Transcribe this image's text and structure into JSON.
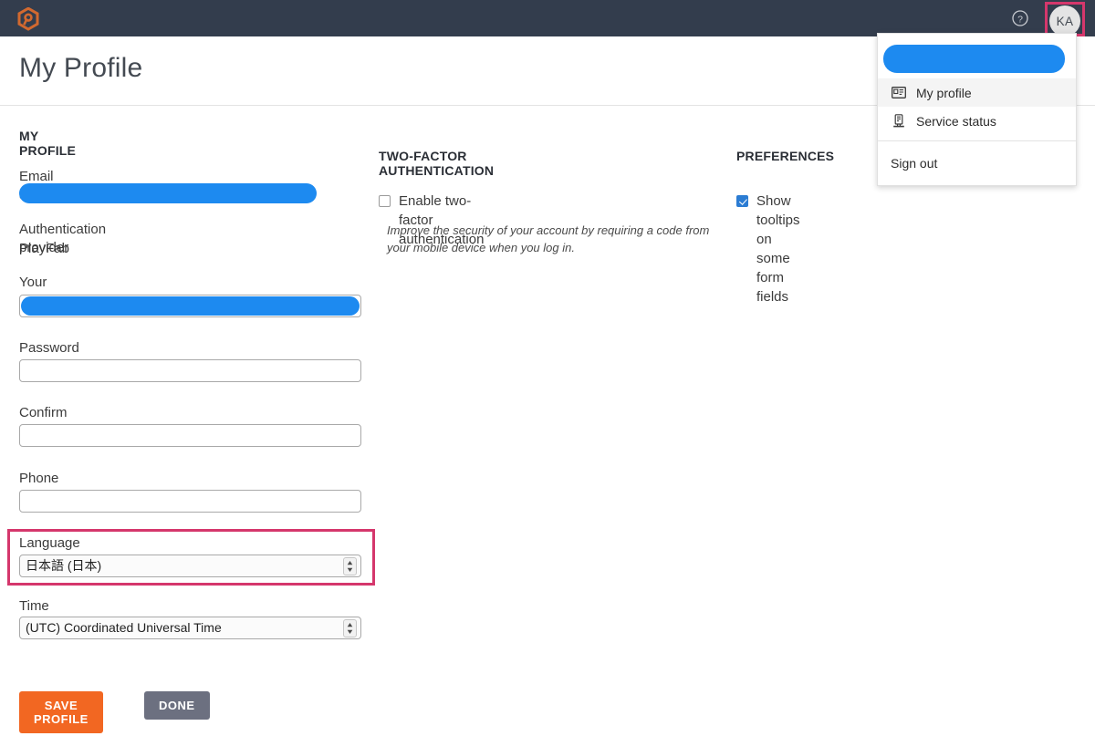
{
  "topbar": {
    "logo_name": "playfab-logo",
    "help_label": "help-icon",
    "avatar_initials": "KA"
  },
  "page": {
    "title": "My Profile"
  },
  "colors": {
    "topbar_bg": "#333d4d",
    "accent_orange": "#f26722",
    "highlight_pink": "#d5376c",
    "redaction_blue": "#1d8af0",
    "checkbox_blue": "#2b7cd3",
    "done_gray": "#6c7080"
  },
  "profile": {
    "section_title": "MY PROFILE",
    "email_label": "Email address",
    "email_value": "",
    "auth_provider_label": "Authentication provider",
    "auth_provider_value": "PlayFab",
    "name_label": "Your name",
    "name_value": "",
    "password_label": "Password",
    "password_value": "",
    "confirm_password_label": "Confirm password",
    "confirm_password_value": "",
    "phone_label": "Phone number",
    "phone_value": "",
    "language_label": "Language",
    "language_value": "日本語 (日本)",
    "timezone_label": "Time zone",
    "timezone_value": "(UTC) Coordinated Universal Time"
  },
  "twofactor": {
    "section_title": "TWO-FACTOR AUTHENTICATION",
    "enable_label": "Enable two-factor authentication",
    "enable_checked": false,
    "hint_line1": "Improve the security of your account by requiring a code from",
    "hint_line2": "your mobile device when you log in."
  },
  "preferences": {
    "section_title": "PREFERENCES",
    "tooltips_label": "Show tooltips on some form fields",
    "tooltips_checked": true
  },
  "actions": {
    "save_label": "SAVE PROFILE",
    "done_label": "DONE"
  },
  "user_menu": {
    "account_name_value": "",
    "items": [
      {
        "label": "My profile",
        "icon": "id-card-icon"
      },
      {
        "label": "Service status",
        "icon": "server-icon"
      }
    ],
    "signout_label": "Sign out"
  }
}
